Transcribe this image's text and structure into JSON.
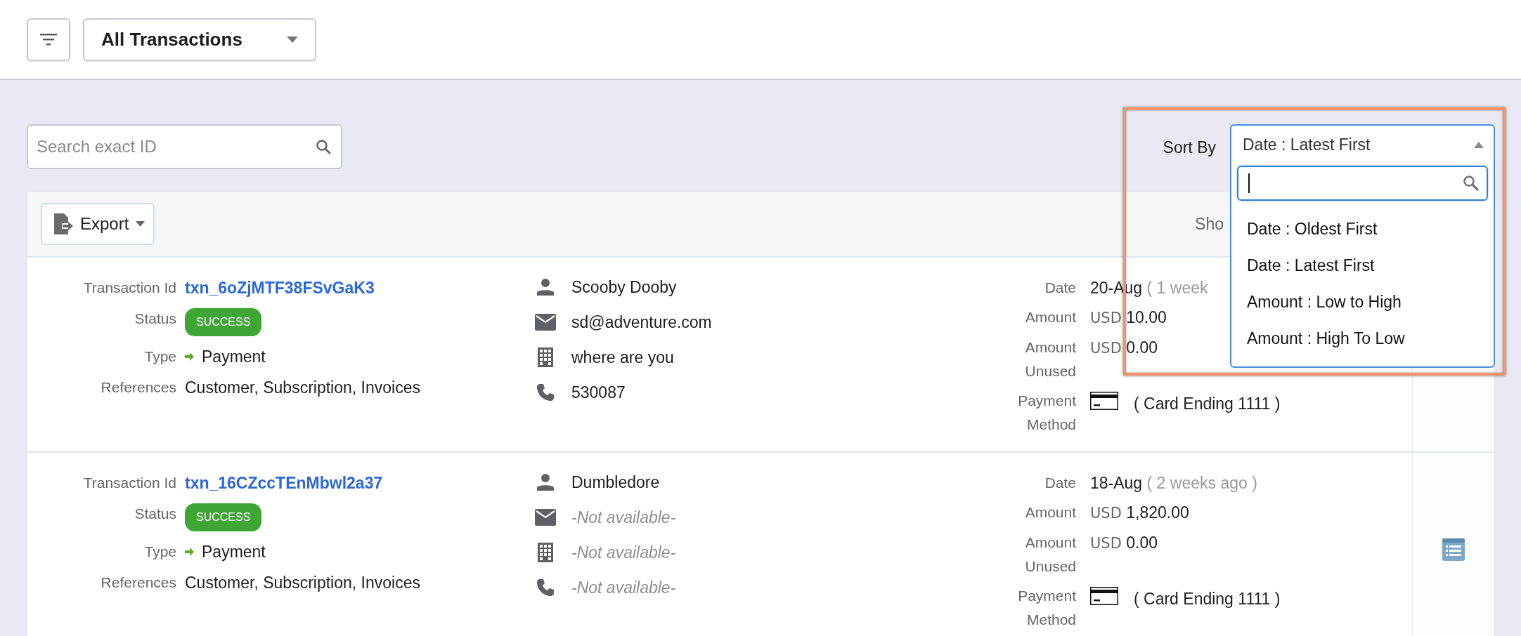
{
  "view_select": {
    "value": "All Transactions"
  },
  "search": {
    "placeholder": "Search exact ID"
  },
  "sort": {
    "label": "Sort By",
    "value": "Date : Latest First",
    "expanded": true,
    "options": [
      {
        "label": "Date : Oldest First"
      },
      {
        "label": "Date : Latest First"
      },
      {
        "label": "Amount : Low to High"
      },
      {
        "label": "Amount : High To Low"
      }
    ]
  },
  "export_button": {
    "label": "Export"
  },
  "showing_text": "Sho",
  "transactions": [
    {
      "id_label": "Transaction Id",
      "id": "txn_6oZjMTF38FSvGaK3",
      "status_label": "Status",
      "status": "SUCCESS",
      "type_label": "Type",
      "type": "Payment",
      "references_label": "References",
      "references": "Customer, Subscription, Invoices",
      "contacts": [
        {
          "kind": "person",
          "text": "Scooby Dooby",
          "muted": false
        },
        {
          "kind": "email",
          "text": "sd@adventure.com",
          "muted": false
        },
        {
          "kind": "building",
          "text": "where are you",
          "muted": false
        },
        {
          "kind": "phone",
          "text": "530087",
          "muted": false
        }
      ],
      "date_label": "Date",
      "date": "20-Aug",
      "date_relative": "( 1 week",
      "amount_label": "Amount",
      "amount": {
        "currency": "USD",
        "value": "10.00"
      },
      "unused_label": "Amount Unused",
      "unused": {
        "currency": "USD",
        "value": "0.00"
      },
      "method_label": "Payment Method",
      "method": "( Card Ending 1111 )"
    },
    {
      "id_label": "Transaction Id",
      "id": "txn_16CZccTEnMbwl2a37",
      "status_label": "Status",
      "status": "SUCCESS",
      "type_label": "Type",
      "type": "Payment",
      "references_label": "References",
      "references": "Customer, Subscription, Invoices",
      "contacts": [
        {
          "kind": "person",
          "text": "Dumbledore",
          "muted": false
        },
        {
          "kind": "email",
          "text": "-Not available-",
          "muted": true
        },
        {
          "kind": "building",
          "text": "-Not available-",
          "muted": true
        },
        {
          "kind": "phone",
          "text": "-Not available-",
          "muted": true
        }
      ],
      "date_label": "Date",
      "date": "18-Aug",
      "date_relative": "( 2 weeks ago )",
      "amount_label": "Amount",
      "amount": {
        "currency": "USD",
        "value": "1,820.00"
      },
      "unused_label": "Amount Unused",
      "unused": {
        "currency": "USD",
        "value": "0.00"
      },
      "method_label": "Payment Method",
      "method": "( Card Ending 1111 )"
    }
  ]
}
